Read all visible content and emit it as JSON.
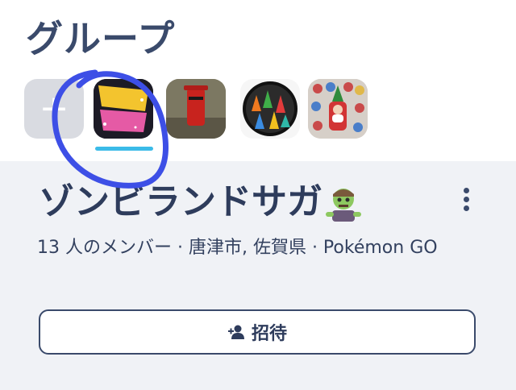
{
  "header": {
    "title": "グループ"
  },
  "groups_strip": {
    "add_icon": "plus-icon",
    "items": [
      {
        "name": "group-zombieland-saga",
        "badge_text": "ゾンビランドサガ",
        "selected": true
      },
      {
        "name": "group-postbox"
      },
      {
        "name": "group-manhole-art"
      },
      {
        "name": "group-santa-stickers"
      }
    ],
    "selected_color": "#3bbbe8"
  },
  "group_detail": {
    "name": "ゾンビランドサガ",
    "emoji_icon": "zombie-emoji-icon",
    "meta": "13 人のメンバー · 唐津市, 佐賀県 · Pokémon GO",
    "invite_label": "招待",
    "invite_icon": "add-person-icon"
  },
  "annotation": {
    "color": "#3d4fe6",
    "shape": "hand-drawn circle around selected group"
  }
}
